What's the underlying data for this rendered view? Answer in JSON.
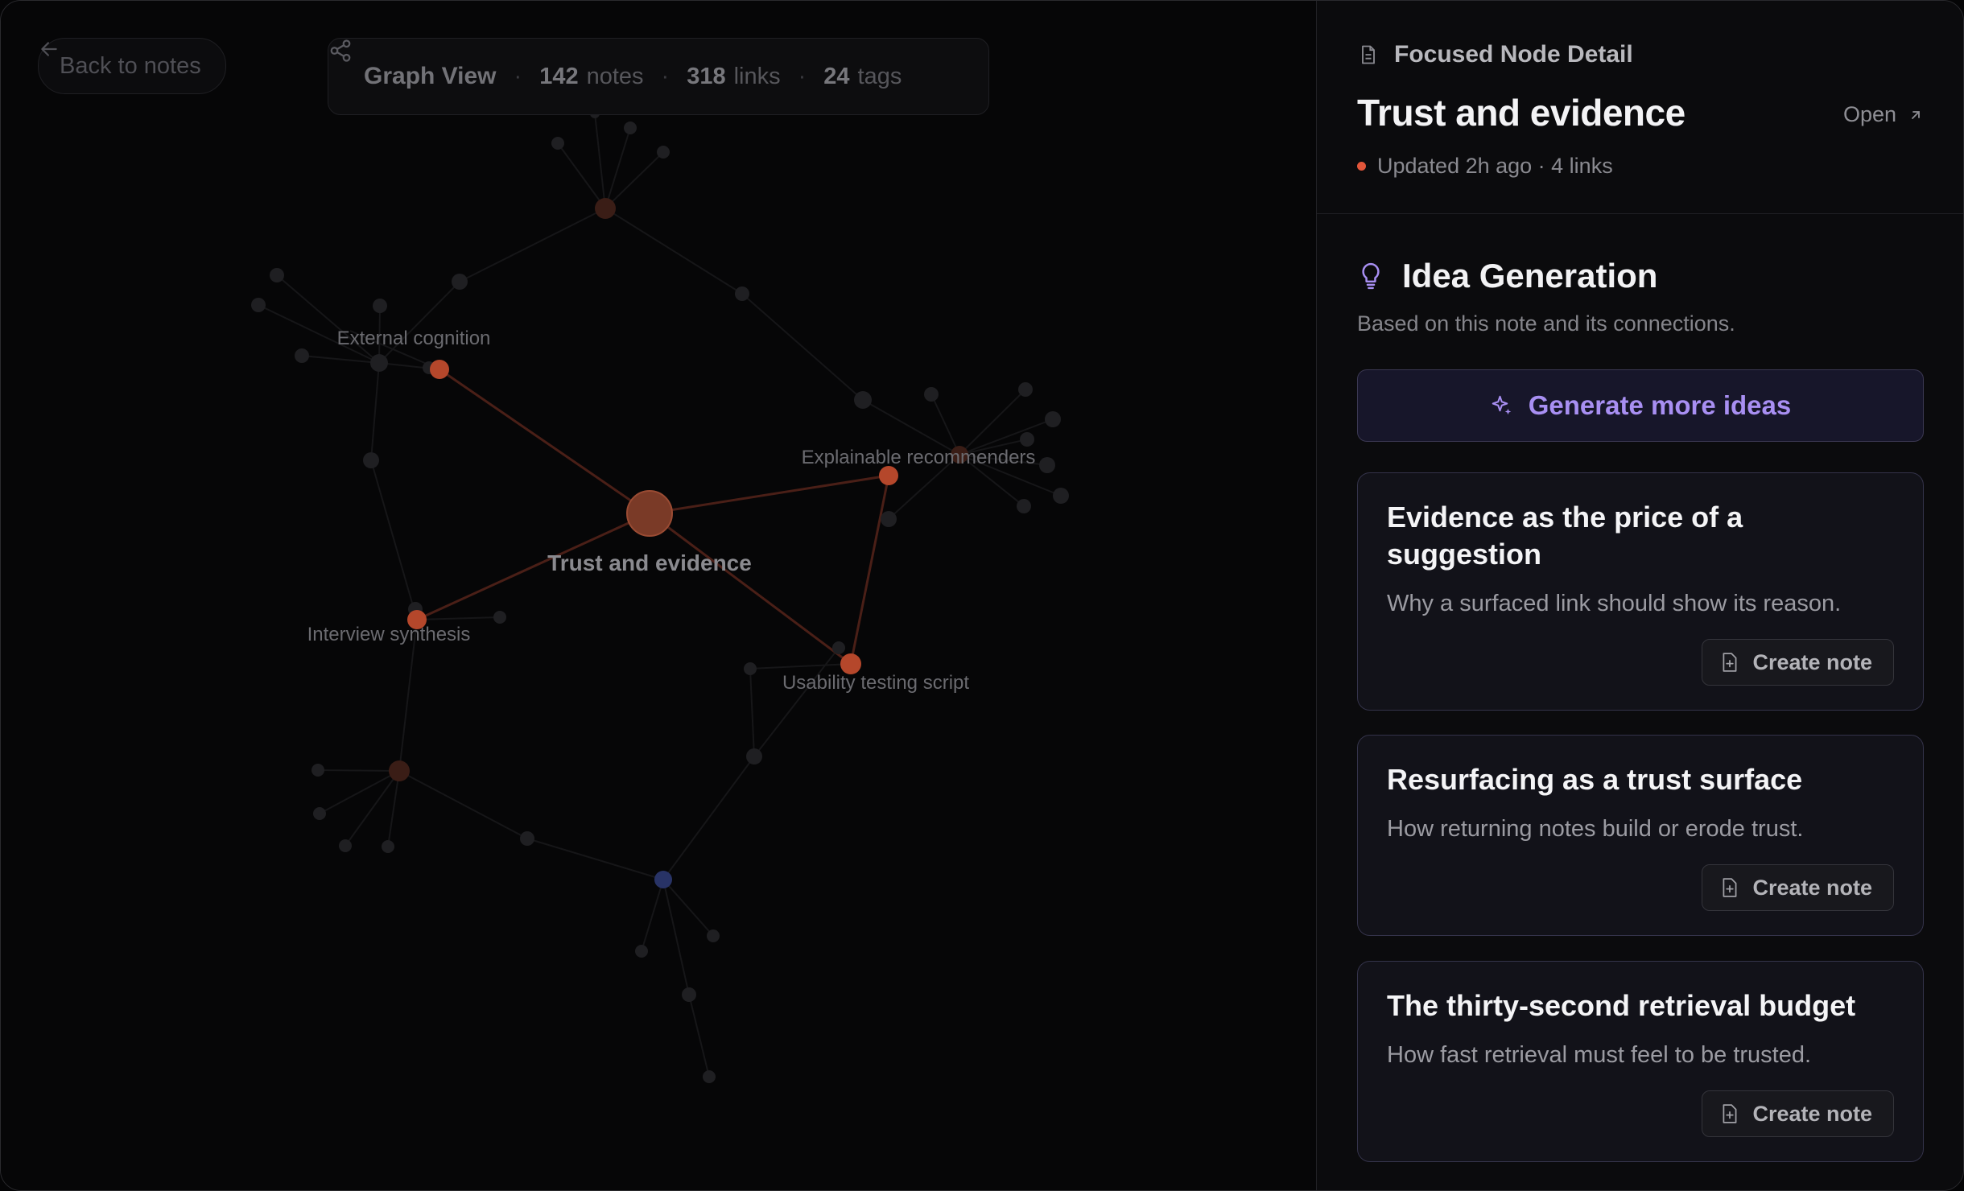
{
  "graph": {
    "back_label": "Back to notes",
    "title": "Graph View",
    "stats": [
      {
        "value": "142",
        "unit": "notes"
      },
      {
        "value": "318",
        "unit": "links"
      },
      {
        "value": "24",
        "unit": "tags"
      }
    ],
    "labels": {
      "main": "Trust and evidence",
      "external": "External cognition",
      "explainable": "Explainable recommenders",
      "interview": "Interview synthesis",
      "usability": "Usability testing script"
    },
    "colors": {
      "focus": "#7a3a27",
      "linked": "#b5472b",
      "muted": "#1f1f22",
      "accent_blue": "#283366"
    }
  },
  "panel": {
    "section_label": "Focused Node Detail",
    "node_title": "Trust and evidence",
    "open_label": "Open",
    "meta": "Updated 2h ago · 4 links",
    "ideas_title": "Idea Generation",
    "ideas_sub": "Based on this note and its connections.",
    "generate_label": "Generate more ideas",
    "cards": [
      {
        "title": "Evidence as the price of a suggestion",
        "desc": "Why a surfaced link should show its reason.",
        "action": "Create note"
      },
      {
        "title": "Resurfacing as a trust surface",
        "desc": "How returning notes build or erode trust.",
        "action": "Create note"
      },
      {
        "title": "The thirty-second retrieval budget",
        "desc": "How fast retrieval must feel to be trusted.",
        "action": "Create note"
      }
    ],
    "colors": {
      "status_dot": "#e2563a",
      "accent_purple": "#a88ff2"
    }
  }
}
